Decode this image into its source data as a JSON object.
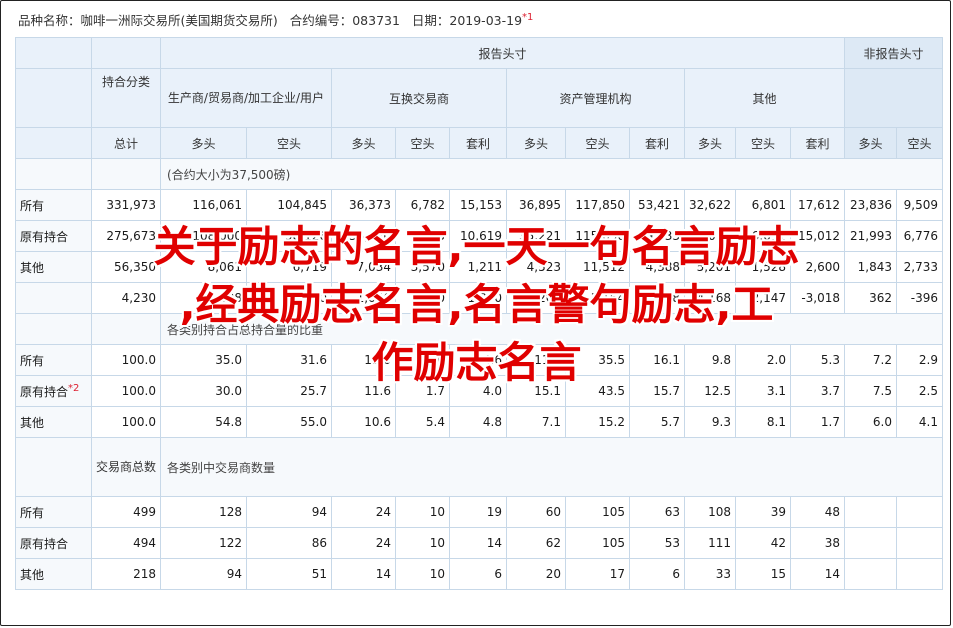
{
  "header": {
    "prefix": "品种名称：",
    "name": "咖啡一洲际交易所(美国期货交易所)",
    "code_label": "合约编号：",
    "code": "083731",
    "date_label": "日期：",
    "date": "2019-03-19",
    "note_mark": "*1"
  },
  "table": {
    "group_reporting": "报告头寸",
    "group_nonreporting": "非报告头寸",
    "category_header": "持合分类",
    "subgroups": [
      "生产商/贸易商/加工企业/用户",
      "互换交易商",
      "资产管理机构",
      "其他"
    ],
    "total_label": "总计",
    "cols": [
      "多头",
      "空头",
      "多头",
      "空头",
      "套利",
      "多头",
      "空头",
      "套利",
      "多头",
      "空头",
      "套利",
      "多头",
      "空头"
    ],
    "section1_note": "(合约大小为37,500磅)",
    "section1_rows": [
      {
        "label": "所有",
        "mark": "",
        "values": [
          "331,973",
          "116,061",
          "104,845",
          "36,373",
          "6,782",
          "15,153",
          "36,895",
          "117,850",
          "53,421",
          "32,622",
          "6,801",
          "17,612",
          "23,836",
          "9,509"
        ]
      },
      {
        "label": "原有持合",
        "mark": "",
        "values": [
          "275,673",
          "108,000",
          "98,126",
          "35,620",
          "7,003",
          "10,619",
          "35,221",
          "115,656",
          "49,033",
          "32,010",
          "6,611",
          "15,012",
          "21,993",
          "6,776"
        ]
      },
      {
        "label": "其他",
        "mark": "",
        "values": [
          "56,350",
          "8,061",
          "6,719",
          "7,034",
          "3,570",
          "1,211",
          "4,523",
          "11,512",
          "4,388",
          "5,201",
          "1,528",
          "2,600",
          "1,843",
          "2,733"
        ]
      },
      {
        "label": "",
        "mark": "",
        "values": [
          "4,230",
          "1,238",
          "4,620",
          "1,056",
          "1,200",
          "1,060",
          "1,208",
          "1,164",
          "1,208",
          "4,168",
          "-2,147",
          "-3,018",
          "362",
          "-396"
        ]
      }
    ],
    "section2_note": "各类别持合占总持合量的比重",
    "section2_rows": [
      {
        "label": "所有",
        "mark": "",
        "values": [
          "100.0",
          "35.0",
          "31.6",
          "11.0",
          "2.0",
          "4.6",
          "11.1",
          "35.5",
          "16.1",
          "9.8",
          "2.0",
          "5.3",
          "7.2",
          "2.9"
        ]
      },
      {
        "label": "原有持合",
        "mark": "*2",
        "values": [
          "100.0",
          "30.0",
          "25.7",
          "11.6",
          "1.7",
          "4.0",
          "15.1",
          "43.5",
          "15.7",
          "12.5",
          "3.1",
          "3.7",
          "7.5",
          "2.5"
        ]
      },
      {
        "label": "其他",
        "mark": "",
        "values": [
          "100.0",
          "54.8",
          "55.0",
          "10.6",
          "5.4",
          "4.8",
          "7.1",
          "15.2",
          "5.7",
          "9.3",
          "8.1",
          "1.7",
          "6.0",
          "4.1"
        ]
      }
    ],
    "trader_header": "交易商总数",
    "section3_note": "各类别中交易商数量",
    "section3_rows": [
      {
        "label": "所有",
        "mark": "",
        "values": [
          "499",
          "128",
          "94",
          "24",
          "10",
          "19",
          "60",
          "105",
          "63",
          "108",
          "39",
          "48",
          "",
          ""
        ]
      },
      {
        "label": "原有持合",
        "mark": "",
        "values": [
          "494",
          "122",
          "86",
          "24",
          "10",
          "14",
          "62",
          "105",
          "53",
          "111",
          "42",
          "38",
          "",
          ""
        ]
      },
      {
        "label": "其他",
        "mark": "",
        "values": [
          "218",
          "94",
          "51",
          "14",
          "10",
          "6",
          "20",
          "17",
          "6",
          "33",
          "15",
          "14",
          "",
          ""
        ]
      }
    ]
  },
  "overlay": {
    "line1": "关于励志的名言,一天一句名言励志",
    "line2": ",经典励志名言,名言警句励志,工",
    "line3": "作励志名言"
  },
  "colors": {
    "overlay_text": "#e00000",
    "border": "#c7d8e8",
    "header_bg": "#e9f1fa"
  }
}
